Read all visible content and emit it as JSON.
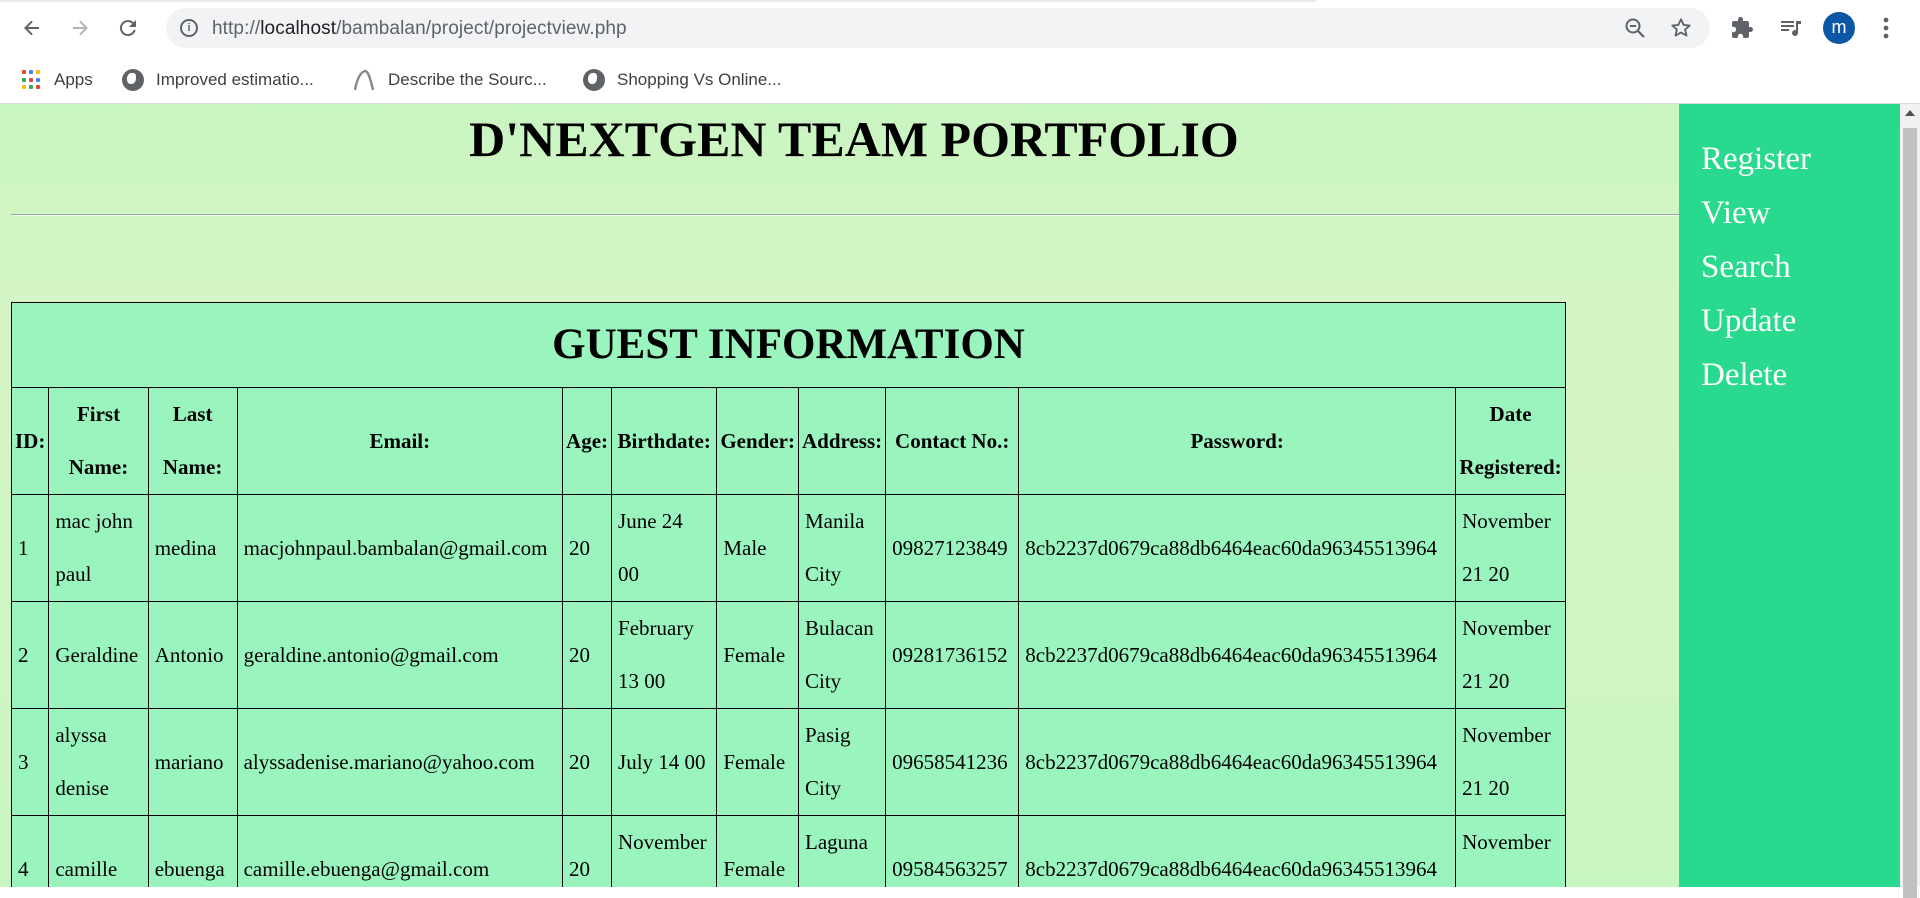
{
  "browser": {
    "url_prefix": "http://",
    "url_host": "localhost",
    "url_path": "/bambalan/project/projectview.php",
    "avatar_letter": "m",
    "bookmarks": [
      {
        "label": "Apps"
      },
      {
        "label": "Improved estimatio..."
      },
      {
        "label": "Describe the Sourc..."
      },
      {
        "label": "Shopping Vs Online..."
      }
    ]
  },
  "page": {
    "heading": "D'NEXTGEN TEAM PORTFOLIO",
    "nav": [
      "Register",
      "View",
      "Search",
      "Update",
      "Delete"
    ],
    "table_title": "GUEST INFORMATION",
    "columns": [
      {
        "l1": "ID:",
        "l2": ""
      },
      {
        "l1": "First",
        "l2": "Name:"
      },
      {
        "l1": "Last",
        "l2": "Name:"
      },
      {
        "l1": "Email:",
        "l2": ""
      },
      {
        "l1": "Age:",
        "l2": ""
      },
      {
        "l1": "Birthdate:",
        "l2": ""
      },
      {
        "l1": "Gender:",
        "l2": ""
      },
      {
        "l1": "Address:",
        "l2": ""
      },
      {
        "l1": "Contact No.:",
        "l2": ""
      },
      {
        "l1": "Password:",
        "l2": ""
      },
      {
        "l1": "Date",
        "l2": "Registered:"
      }
    ],
    "rows": [
      {
        "id": "1",
        "first": [
          "mac john",
          "paul"
        ],
        "last": "medina",
        "email": "macjohnpaul.bambalan@gmail.com",
        "age": "20",
        "birth": [
          "June 24",
          "00"
        ],
        "gender": "Male",
        "address": [
          "Manila",
          "City"
        ],
        "contact": "09827123849",
        "password": "8cb2237d0679ca88db6464eac60da96345513964",
        "date": [
          "November",
          "21 20"
        ]
      },
      {
        "id": "2",
        "first": [
          "Geraldine"
        ],
        "last": "Antonio",
        "email": "geraldine.antonio@gmail.com",
        "age": "20",
        "birth": [
          "February",
          "13 00"
        ],
        "gender": "Female",
        "address": [
          "Bulacan",
          "City"
        ],
        "contact": "09281736152",
        "password": "8cb2237d0679ca88db6464eac60da96345513964",
        "date": [
          "November",
          "21 20"
        ]
      },
      {
        "id": "3",
        "first": [
          "alyssa",
          "denise"
        ],
        "last": "mariano",
        "email": "alyssadenise.mariano@yahoo.com",
        "age": "20",
        "birth": [
          "July 14 00"
        ],
        "gender": "Female",
        "address": [
          "Pasig",
          "City"
        ],
        "contact": "09658541236",
        "password": "8cb2237d0679ca88db6464eac60da96345513964",
        "date": [
          "November",
          "21 20"
        ]
      },
      {
        "id": "4",
        "first": [
          "camille"
        ],
        "last": "ebuenga",
        "email": "camille.ebuenga@gmail.com",
        "age": "20",
        "birth": [
          "November"
        ],
        "gender": "Female",
        "address": [
          "Laguna"
        ],
        "contact": "09584563257",
        "password": "8cb2237d0679ca88db6464eac60da96345513964",
        "date": [
          "November"
        ]
      }
    ]
  }
}
